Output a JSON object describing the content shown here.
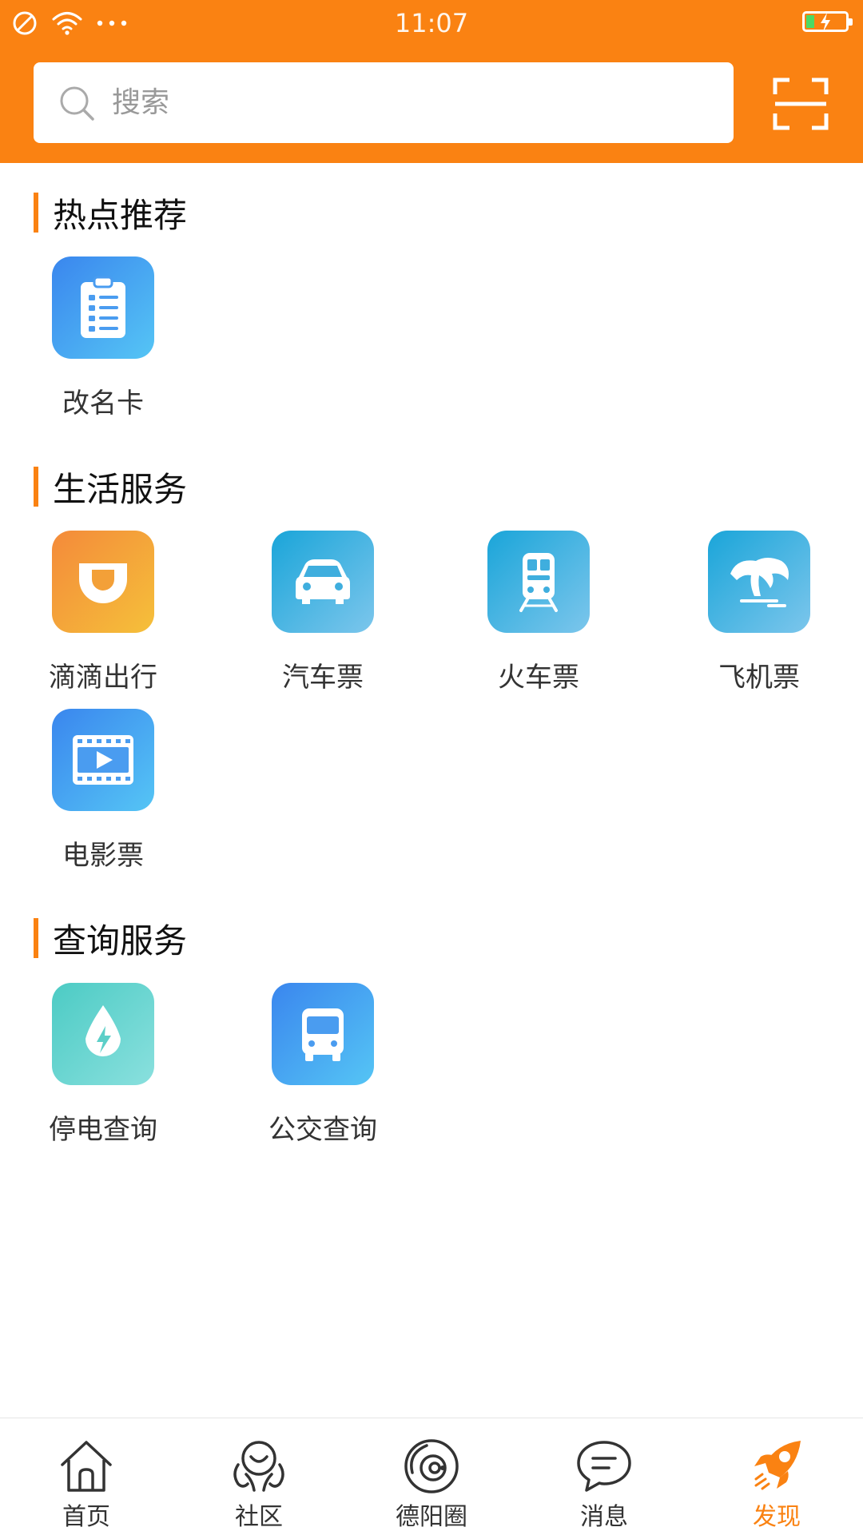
{
  "status_bar": {
    "time": "11:07"
  },
  "search": {
    "placeholder": "搜索"
  },
  "colors": {
    "accent": "#FA8212"
  },
  "sections": [
    {
      "title": "热点推荐",
      "items": [
        {
          "label": "改名卡",
          "icon": "clipboard-list-icon"
        }
      ]
    },
    {
      "title": "生活服务",
      "items": [
        {
          "label": "滴滴出行",
          "icon": "didi-icon"
        },
        {
          "label": "汽车票",
          "icon": "car-icon"
        },
        {
          "label": "火车票",
          "icon": "train-icon"
        },
        {
          "label": "飞机票",
          "icon": "palm-beach-icon"
        },
        {
          "label": "电影票",
          "icon": "film-icon"
        }
      ]
    },
    {
      "title": "查询服务",
      "items": [
        {
          "label": "停电查询",
          "icon": "power-drop-icon"
        },
        {
          "label": "公交查询",
          "icon": "bus-icon"
        }
      ]
    }
  ],
  "tabbar": {
    "active": "发现",
    "items": [
      {
        "label": "首页",
        "icon": "home-icon"
      },
      {
        "label": "社区",
        "icon": "community-icon"
      },
      {
        "label": "德阳圈",
        "icon": "planet-icon"
      },
      {
        "label": "消息",
        "icon": "chat-bubble-icon"
      },
      {
        "label": "发现",
        "icon": "rocket-icon"
      }
    ]
  }
}
